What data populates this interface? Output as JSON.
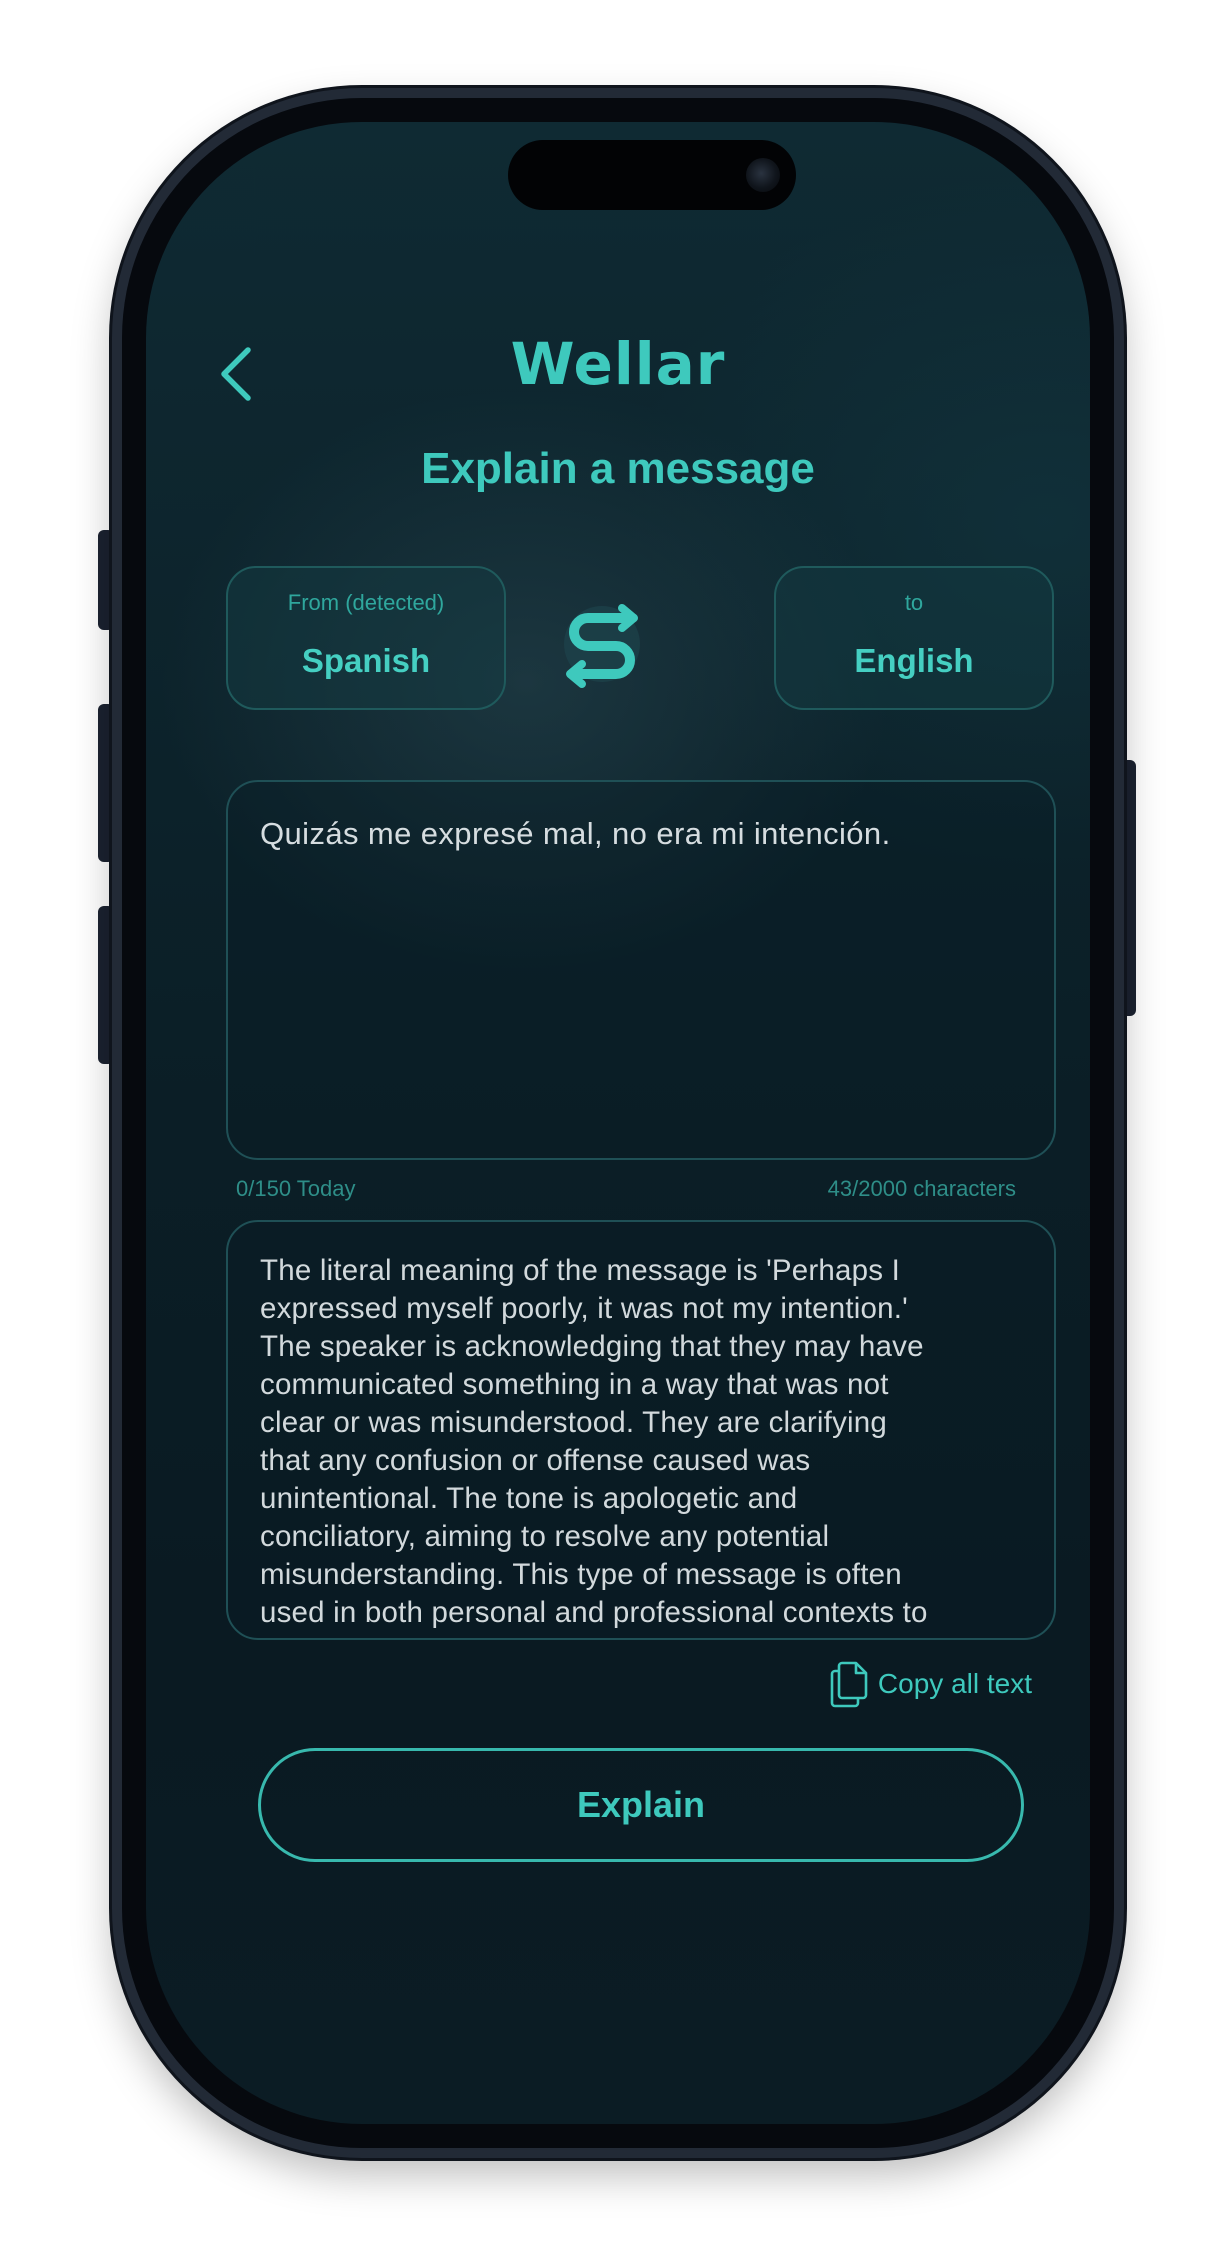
{
  "app": {
    "brand": "Wellar",
    "title": "Explain a message"
  },
  "icons": {
    "back": "chevron-left-icon",
    "swap": "swap-arrows-icon",
    "copy": "copy-document-icon"
  },
  "languages": {
    "from_caption": "From (detected)",
    "from_value": "Spanish",
    "to_caption": "to",
    "to_value": "English"
  },
  "input": {
    "text": "Quizás me expresé mal, no era mi intención."
  },
  "counters": {
    "daily": "0/150 Today",
    "characters": "43/2000 characters"
  },
  "output": {
    "lines": [
      "The literal meaning of the message is 'Perhaps I",
      "expressed myself poorly, it was not my intention.'",
      "The speaker is acknowledging that they may have",
      "communicated something in a way that was not",
      "clear or was misunderstood. They are clarifying",
      "that any confusion or offense caused was",
      "unintentional. The tone is apologetic and",
      "conciliatory, aiming to resolve any potential",
      "misunderstanding. This type of message is often",
      "used in both personal and professional contexts to"
    ]
  },
  "actions": {
    "copy_label": "Copy all text",
    "explain_label": "Explain"
  },
  "colors": {
    "accent": "#3ec9bd",
    "background": "#0b1f27",
    "text": "#d2d9dc"
  }
}
